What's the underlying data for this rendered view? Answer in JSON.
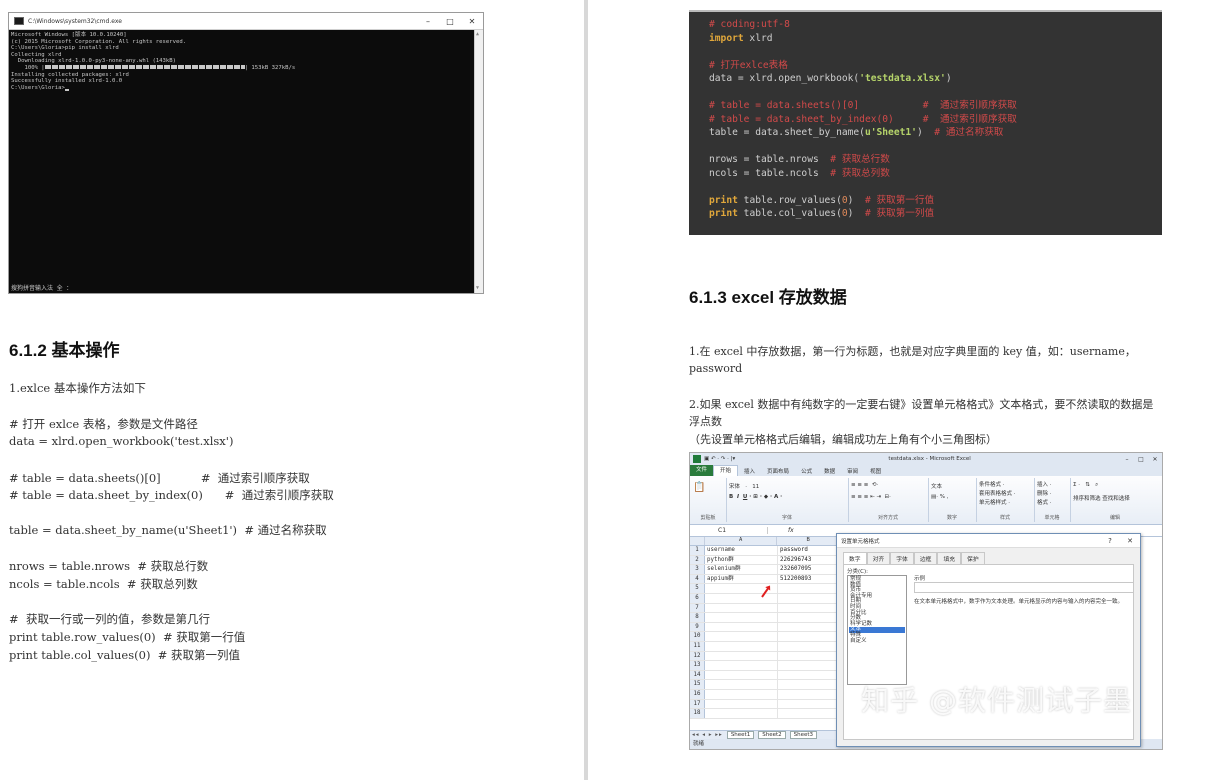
{
  "left": {
    "cmd": {
      "title": "C:\\Windows\\system32\\cmd.exe",
      "controls": [
        "–",
        "□",
        "✕"
      ],
      "lines": [
        "Microsoft Windows [版本 10.0.10240]",
        "(c) 2015 Microsoft Corporation. All rights reserved.",
        "",
        "C:\\Users\\Gloria>pip install xlrd",
        "Collecting xlrd",
        "  Downloading xlrd-1.0.0-py3-none-any.whl (143kB)"
      ],
      "progress_pct": "    100% |",
      "progress_value": 100,
      "progress_tail": "| 153kB 327kB/s",
      "lines_after": [
        "Installing collected packages: xlrd",
        "Successfully installed xlrd-1.0.0",
        "",
        "C:\\Users\\Gloria>"
      ],
      "ime": "搜狗拼音输入法 全 ："
    },
    "heading": "6.1.2  基本操作",
    "intro": "1.exlce 基本操作方法如下",
    "code_lines": [
      "# 打开 exlce 表格，参数是文件路径",
      "data = xlrd.open_workbook('test.xlsx')",
      "",
      "# table = data.sheets()[0]           #  通过索引顺序获取",
      "# table = data.sheet_by_index(0)      #  通过索引顺序获取",
      "",
      "table = data.sheet_by_name(u'Sheet1')  # 通过名称获取",
      "",
      "nrows = table.nrows  # 获取总行数",
      "ncols = table.ncols  # 获取总列数",
      "",
      "#  获取一行或一列的值，参数是第几行",
      "print table.row_values(0)  # 获取第一行值",
      "print table.col_values(0)  # 获取第一列值"
    ]
  },
  "right": {
    "code": {
      "l1": "# coding:utf-8",
      "l2_kw": "import",
      "l2_id": " xlrd",
      "l3": "# 打开exlce表格",
      "l4_a": "data = xlrd.open_workbook(",
      "l4_s": "'testdata.xlsx'",
      "l4_b": ")",
      "l5": "# table = data.sheets()[0]           #  通过索引顺序获取",
      "l6": "# table = data.sheet_by_index(0)     #  通过索引顺序获取",
      "l7_a": "table = data.sheet_by_name(",
      "l7_s": "u'Sheet1'",
      "l7_b": ")  ",
      "l7_c": "# 通过名称获取",
      "l8_a": "nrows = table.nrows  ",
      "l8_c": "# 获取总行数",
      "l9_a": "ncols = table.ncols  ",
      "l9_c": "# 获取总列数",
      "l10_kw": "print",
      "l10_a": " table.row_values(",
      "l10_n": "0",
      "l10_b": ")  ",
      "l10_c": "# 获取第一行值",
      "l11_kw": "print",
      "l11_a": " table.col_values(",
      "l11_n": "0",
      "l11_b": ")  ",
      "l11_c": "# 获取第一列值"
    },
    "heading": "6.1.3 excel 存放数据",
    "para1": "1.在 excel 中存放数据，第一行为标题，也就是对应字典里面的 key 值，如：username，password",
    "para2": "2.如果 excel 数据中有纯数字的一定要右键》设置单元格格式》文本格式，要不然读取的数据是浮点数",
    "para3": "（先设置单元格格式后编辑，编辑成功左上角有个小三角图标）",
    "excel": {
      "title": "testdata.xlsx - Microsoft Excel",
      "quick_access": "▣ ↶ · ↷ · |▾",
      "window_controls": [
        "–",
        "□",
        "✕"
      ],
      "tabs": [
        "文件",
        "开始",
        "插入",
        "页面布局",
        "公式",
        "数据",
        "审阅",
        "视图"
      ],
      "groups": [
        "剪贴板",
        "字体",
        "对齐方式",
        "数字",
        "样式",
        "单元格",
        "编辑"
      ],
      "font_name": "宋体",
      "font_size": "11",
      "number_format": "文本",
      "style_items": [
        "条件格式 ·",
        "套用表格格式 ·",
        "单元格样式 ·"
      ],
      "cell_items": [
        "插入 ·",
        "删除 ·",
        "格式 ·"
      ],
      "edit_items": [
        "排序和筛选",
        "查找和选择"
      ],
      "namebox": "C1",
      "fx": "fx",
      "columns": [
        "",
        "A",
        "B"
      ],
      "rows": [
        {
          "n": "1",
          "a": "username",
          "b": "password"
        },
        {
          "n": "2",
          "a": "python群",
          "b": "226296743"
        },
        {
          "n": "3",
          "a": "selenium群",
          "b": "232607095"
        },
        {
          "n": "4",
          "a": "appium群",
          "b": "512200893"
        },
        {
          "n": "5",
          "a": "",
          "b": ""
        },
        {
          "n": "6",
          "a": "",
          "b": ""
        },
        {
          "n": "7",
          "a": "",
          "b": ""
        },
        {
          "n": "8",
          "a": "",
          "b": ""
        },
        {
          "n": "9",
          "a": "",
          "b": ""
        },
        {
          "n": "10",
          "a": "",
          "b": ""
        },
        {
          "n": "11",
          "a": "",
          "b": ""
        },
        {
          "n": "12",
          "a": "",
          "b": ""
        },
        {
          "n": "13",
          "a": "",
          "b": ""
        },
        {
          "n": "14",
          "a": "",
          "b": ""
        },
        {
          "n": "15",
          "a": "",
          "b": ""
        },
        {
          "n": "16",
          "a": "",
          "b": ""
        },
        {
          "n": "17",
          "a": "",
          "b": ""
        },
        {
          "n": "18",
          "a": "",
          "b": ""
        }
      ],
      "sheet_nav": "◂◂ ◂ ▸ ▸▸",
      "sheets": [
        "Sheet1",
        "Sheet2",
        "Sheet3"
      ],
      "status": "就绪",
      "dialog": {
        "title": "设置单元格格式",
        "help": "?",
        "close": "✕",
        "tabs": [
          "数字",
          "对齐",
          "字体",
          "边框",
          "填充",
          "保护"
        ],
        "category_label": "分类(C):",
        "categories": [
          "常规",
          "数值",
          "货币",
          "会计专用",
          "日期",
          "时间",
          "百分比",
          "分数",
          "科学记数",
          "文本",
          "特殊",
          "自定义"
        ],
        "selected": "文本",
        "sample_label": "示例",
        "description": "在文本单元格格式中，数字作为文本处理。单元格显示的内容与输入的内容完全一致。"
      }
    },
    "watermark": "知乎 @软件测试子墨"
  }
}
